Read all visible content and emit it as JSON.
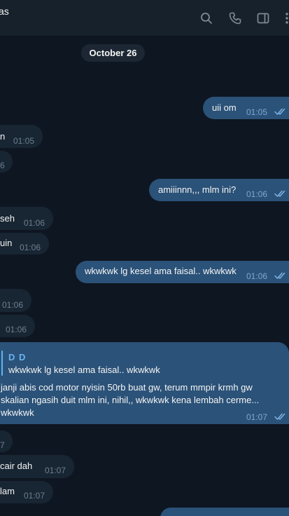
{
  "header": {
    "title": "as",
    "icons": [
      "search-icon",
      "phone-icon",
      "sidebar-toggle-icon",
      "more-icon"
    ]
  },
  "chat": {
    "date": "October 26",
    "messages": [
      {
        "dir": "out",
        "text": "uii om",
        "time": "01:05",
        "read": true
      },
      {
        "dir": "in",
        "text": "n",
        "time": "01:05"
      },
      {
        "dir": "in",
        "text": "",
        "time": "6"
      },
      {
        "dir": "out",
        "text": "amiiinnn,,, mlm ini?",
        "time": "01:06",
        "read": true
      },
      {
        "dir": "in",
        "text": "seh",
        "time": "01:06"
      },
      {
        "dir": "in",
        "text": "uin",
        "time": "01:06"
      },
      {
        "dir": "out",
        "text": "wkwkwk lg kesel ama faisal.. wkwkwk",
        "time": "01:06",
        "read": true
      },
      {
        "dir": "in",
        "text": "",
        "time": "01:06"
      },
      {
        "dir": "in",
        "text": "",
        "time": "01:06"
      },
      {
        "dir": "out",
        "reply_name": "D D",
        "reply_text": "wkwkwk lg kesel ama faisal.. wkwkwk",
        "lines": [
          "janji abis cod motor nyisin 50rb buat gw, terum mmpir krmh gw",
          "skalian ngasih duit mlm ini, nihil,, wkwkwk kena lembah cerme...",
          "wkwkwk"
        ],
        "time": "01:07",
        "read": true
      },
      {
        "dir": "in",
        "text": "",
        "time": "7"
      },
      {
        "dir": "in",
        "text": "cair dah",
        "time": "01:07"
      },
      {
        "dir": "in",
        "text": "lam",
        "time": "01:07"
      }
    ]
  }
}
